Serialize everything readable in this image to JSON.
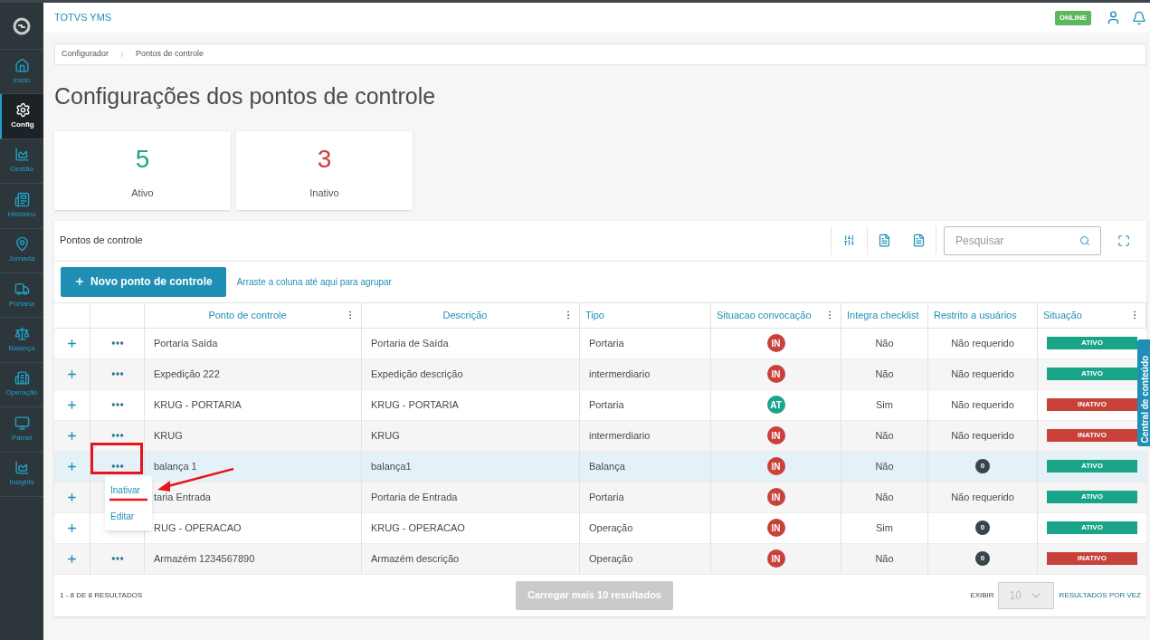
{
  "app": {
    "title": "TOTVS YMS",
    "status": "ONLINE"
  },
  "sidebar": {
    "items": [
      {
        "label": "Início",
        "selected": false
      },
      {
        "label": "Config",
        "selected": true
      },
      {
        "label": "Gestão",
        "selected": false
      },
      {
        "label": "Histórico",
        "selected": false
      },
      {
        "label": "Jornada",
        "selected": false
      },
      {
        "label": "Portaria",
        "selected": false
      },
      {
        "label": "Balança",
        "selected": false
      },
      {
        "label": "Operação",
        "selected": false
      },
      {
        "label": "Painel",
        "selected": false
      },
      {
        "label": "Insights",
        "selected": false
      }
    ]
  },
  "breadcrumb": [
    "Configurador",
    "Pontos de controle"
  ],
  "page_title": "Configurações dos pontos de controle",
  "summary_cards": [
    {
      "value": "5",
      "label": "Ativo",
      "color": "#1aa589"
    },
    {
      "value": "3",
      "label": "Inativo",
      "color": "#c8413b"
    }
  ],
  "panel": {
    "title": "Pontos de controle",
    "search": {
      "placeholder": "Pesquisar"
    },
    "new_button": "Novo ponto de controle",
    "group_hint": "Arraste a coluna até aqui para agrupar",
    "columns": [
      {
        "label": "Ponto de controle",
        "menu": true
      },
      {
        "label": "Descrição",
        "menu": true
      },
      {
        "label": "Tipo",
        "menu": false
      },
      {
        "label": "Situacao convocação",
        "menu": true
      },
      {
        "label": "Integra checklist",
        "menu": false
      },
      {
        "label": "Restrito a usuários",
        "menu": false
      },
      {
        "label": "Situação",
        "menu": true
      }
    ],
    "rows": [
      {
        "name": "Portaria Saída",
        "description": "Portaria de Saída",
        "type": "Portaria",
        "call_status": "IN",
        "call_active": false,
        "checklist": "Não",
        "restricted": {
          "kind": "text",
          "text": "Não requerido"
        },
        "status": "ATIVO",
        "active": true,
        "hovered": false
      },
      {
        "name": "Expedição 222",
        "description": "Expedição descrição",
        "type": "intermerdiario",
        "call_status": "IN",
        "call_active": false,
        "checklist": "Não",
        "restricted": {
          "kind": "text",
          "text": "Não requerido"
        },
        "status": "ATIVO",
        "active": true,
        "hovered": false
      },
      {
        "name": "KRUG - PORTARIA",
        "description": "KRUG - PORTARIA",
        "type": "Portaria",
        "call_status": "AT",
        "call_active": true,
        "checklist": "Sim",
        "restricted": {
          "kind": "text",
          "text": "Não requerido"
        },
        "status": "INATIVO",
        "active": false,
        "hovered": false
      },
      {
        "name": "KRUG",
        "description": "KRUG",
        "type": "intermerdiario",
        "call_status": "IN",
        "call_active": false,
        "checklist": "Não",
        "restricted": {
          "kind": "text",
          "text": "Não requerido"
        },
        "status": "INATIVO",
        "active": false,
        "hovered": false
      },
      {
        "name": "balança 1",
        "description": "balança1",
        "type": "Balança",
        "call_status": "IN",
        "call_active": false,
        "checklist": "Não",
        "restricted": {
          "kind": "count",
          "text": "0"
        },
        "status": "ATIVO",
        "active": true,
        "hovered": true
      },
      {
        "name": "taria Entrada",
        "description": "Portaria de Entrada",
        "type": "Portaria",
        "call_status": "IN",
        "call_active": false,
        "checklist": "Não",
        "restricted": {
          "kind": "text",
          "text": "Não requerido"
        },
        "status": "ATIVO",
        "active": true,
        "hovered": false
      },
      {
        "name": "RUG - OPERACAO",
        "description": "KRUG - OPERACAO",
        "type": "Operação",
        "call_status": "IN",
        "call_active": false,
        "checklist": "Sim",
        "restricted": {
          "kind": "count",
          "text": "0"
        },
        "status": "ATIVO",
        "active": true,
        "hovered": false
      },
      {
        "name": "Armazém 1234567890",
        "description": "Armazém descrição",
        "type": "Operação",
        "call_status": "IN",
        "call_active": false,
        "checklist": "Não",
        "restricted": {
          "kind": "count",
          "text": "0"
        },
        "status": "INATIVO",
        "active": false,
        "hovered": false
      }
    ],
    "context_menu": {
      "items": [
        "Inativar",
        "Editar"
      ]
    },
    "footer": {
      "count": "1 - 8 DE 8 RESULTADOS",
      "load_more": "Carregar mais 10 resultados",
      "show_label": "EXIBIR",
      "page_size": "10",
      "per_page_label": "RESULTADOS POR VEZ"
    }
  },
  "side_tab": "Central de conteúdo"
}
